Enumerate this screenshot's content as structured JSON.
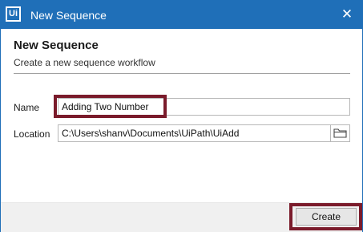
{
  "window": {
    "title": "New Sequence",
    "app_icon_text": "Ui",
    "close_symbol": "✕",
    "icons": {
      "app": "uipath-logo-icon",
      "close": "close-icon",
      "folder": "folder-icon"
    }
  },
  "header": {
    "heading": "New Sequence",
    "subheading": "Create a new sequence workflow"
  },
  "form": {
    "name_label": "Name",
    "name_value": "Adding Two Number",
    "location_label": "Location",
    "location_value": "C:\\Users\\shanv\\Documents\\UiPath\\UiAdd"
  },
  "footer": {
    "create_label": "Create"
  },
  "colors": {
    "titlebar": "#1f6fb8",
    "highlight": "#7a1b2b",
    "footer": "#f0f0f0"
  }
}
